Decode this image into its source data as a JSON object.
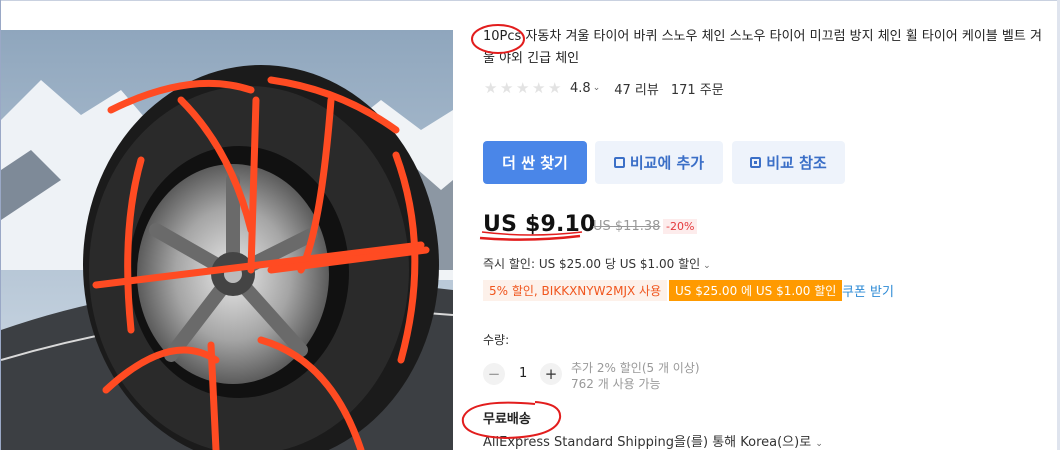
{
  "product": {
    "title": "10Pcs 자동차 겨울 타이어 바퀴 스노우 체인 스노우 타이어 미끄럼 방지 체인 휠 타이어 케이블 벨트 겨울 야외 긴급 체인",
    "rating": "4.8",
    "reviews": "47 리뷰",
    "orders": "171 주문",
    "image_alt": "tire with orange snow chains"
  },
  "actions": {
    "find_cheaper": "더 싼 찾기",
    "add_compare": "비교에 추가",
    "view_compare": "비교 참조"
  },
  "price": {
    "current": "US $9.10",
    "original": "US $11.38",
    "discount": "-20%"
  },
  "promotions": {
    "instant_discount": "즉시 할인: US $25.00 당 US $1.00 할인",
    "coupon_code": "5% 할인, BIKKXNYW2MJX 사용",
    "coupon_threshold": "US $25.00 에 US $1.00 할인",
    "get_coupon": "쿠폰 받기"
  },
  "quantity": {
    "label": "수량:",
    "value": "1",
    "minus": "−",
    "plus": "+",
    "bulk_note": "추가 2% 할인(5 개 이상)",
    "available": "762 개 사용 가능"
  },
  "shipping": {
    "label": "무료배송",
    "method": "AliExpress Standard Shipping을(를) 통해 Korea(으)로"
  },
  "icons": {
    "star": "star-icon",
    "chevron": "chevron-down-icon",
    "compare": "compare-add-icon",
    "view": "compare-view-icon"
  },
  "colors": {
    "primary_button": "#4a86e8",
    "accent_orange": "#ff9a00",
    "coupon_text": "#f0561e",
    "annotation_red": "#e21d1d"
  }
}
